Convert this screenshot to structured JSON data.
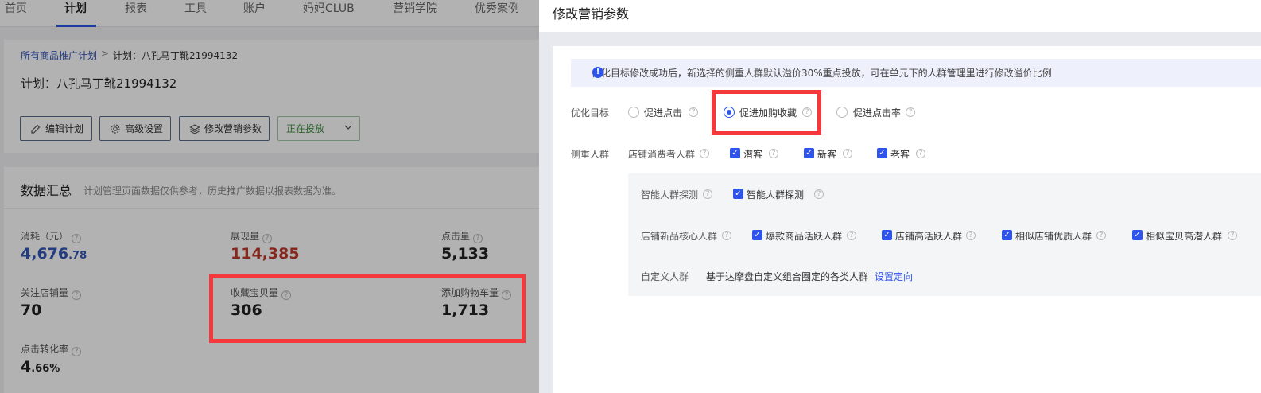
{
  "topnav": {
    "items": [
      "首页",
      "计划",
      "报表",
      "工具",
      "账户",
      "妈妈CLUB",
      "营销学院",
      "优秀案例"
    ],
    "active_index": 1
  },
  "breadcrumb": {
    "link": "所有商品推广计划",
    "separator": ">",
    "current": "计划：八孔马丁靴21994132"
  },
  "plan": {
    "title": "计划：八孔马丁靴21994132",
    "buttons": {
      "edit": "编辑计划",
      "advanced": "高级设置",
      "marketing": "修改营销参数"
    },
    "status": "正在投放"
  },
  "data_summary": {
    "title": "数据汇总",
    "subtitle": "计划管理页面数据仅供参考，历史推广数据以报表数据为准。",
    "metrics": {
      "cost": {
        "label": "消耗（元）",
        "int": "4,676",
        "dec": ".78"
      },
      "impressions": {
        "label": "展现量",
        "value": "114,385"
      },
      "clicks": {
        "label": "点击量",
        "value": "5,133"
      },
      "store_follows": {
        "label": "关注店铺量",
        "value": "70"
      },
      "favorites": {
        "label": "收藏宝贝量",
        "value": "306"
      },
      "add_cart": {
        "label": "添加购物车量",
        "value": "1,713"
      },
      "ctr": {
        "label": "点击转化率",
        "int": "4",
        "dec": ".66%"
      }
    },
    "colors": {
      "cost": "#3355b6",
      "impressions": "#c0392b"
    }
  },
  "drawer": {
    "title": "修改营销参数",
    "notice": "优化目标修改成功后，新选择的侧重人群默认溢价30%重点投放，可在单元下的人群管理里进行修改溢价比例",
    "goal": {
      "label": "优化目标",
      "options": [
        "促进点击",
        "促进加购收藏",
        "促进点击率"
      ],
      "selected_index": 1
    },
    "audience": {
      "label": "侧重人群",
      "store_consumer": {
        "label": "店铺消费者人群",
        "options": [
          "潜客",
          "新客",
          "老客"
        ]
      },
      "smart": {
        "label": "智能人群探测",
        "option": "智能人群探测"
      },
      "new_core": {
        "label": "店铺新品核心人群",
        "options": [
          "爆款商品活跃人群",
          "店铺高活跃人群",
          "相似店铺优质人群",
          "相似宝贝高潜人群"
        ]
      },
      "custom": {
        "label": "自定义人群",
        "desc": "基于达摩盘自定义组合圈定的各类人群",
        "link": "设置定向"
      }
    }
  },
  "help_glyph": "?",
  "check_glyph": "✓",
  "notice_glyph": "!"
}
